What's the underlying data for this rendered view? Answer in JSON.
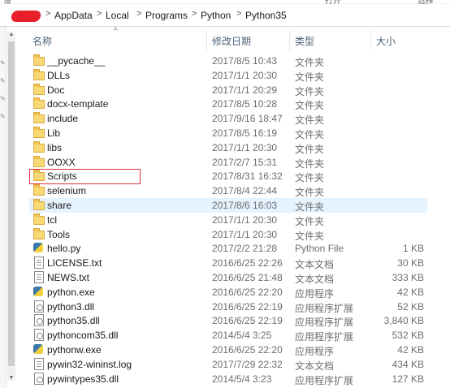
{
  "top_labels": [
    "设",
    "打开",
    "选择"
  ],
  "breadcrumb": {
    "items": [
      "AppData",
      "Local",
      "Programs",
      "Python",
      "Python35"
    ],
    "separator": ">"
  },
  "columns": {
    "name": "名称",
    "date": "修改日期",
    "type": "类型",
    "size": "大小"
  },
  "files": [
    {
      "name": "__pycache__",
      "date": "2017/8/5 10:43",
      "type": "文件夹",
      "size": "",
      "icon": "folder-icon"
    },
    {
      "name": "DLLs",
      "date": "2017/1/1 20:30",
      "type": "文件夹",
      "size": "",
      "icon": "folder-icon"
    },
    {
      "name": "Doc",
      "date": "2017/1/1 20:29",
      "type": "文件夹",
      "size": "",
      "icon": "folder-icon"
    },
    {
      "name": "docx-template",
      "date": "2017/8/5 10:28",
      "type": "文件夹",
      "size": "",
      "icon": "folder-icon"
    },
    {
      "name": "include",
      "date": "2017/9/16 18:47",
      "type": "文件夹",
      "size": "",
      "icon": "folder-icon"
    },
    {
      "name": "Lib",
      "date": "2017/8/5 16:19",
      "type": "文件夹",
      "size": "",
      "icon": "folder-icon"
    },
    {
      "name": "libs",
      "date": "2017/1/1 20:30",
      "type": "文件夹",
      "size": "",
      "icon": "folder-icon"
    },
    {
      "name": "OOXX",
      "date": "2017/2/7 15:31",
      "type": "文件夹",
      "size": "",
      "icon": "folder-icon"
    },
    {
      "name": "Scripts",
      "date": "2017/8/31 16:32",
      "type": "文件夹",
      "size": "",
      "icon": "folder-icon"
    },
    {
      "name": "selenium",
      "date": "2017/8/4 22:44",
      "type": "文件夹",
      "size": "",
      "icon": "folder-icon"
    },
    {
      "name": "share",
      "date": "2017/8/6 16:03",
      "type": "文件夹",
      "size": "",
      "icon": "folder-icon"
    },
    {
      "name": "tcl",
      "date": "2017/1/1 20:30",
      "type": "文件夹",
      "size": "",
      "icon": "folder-icon"
    },
    {
      "name": "Tools",
      "date": "2017/1/1 20:30",
      "type": "文件夹",
      "size": "",
      "icon": "folder-icon"
    },
    {
      "name": "hello.py",
      "date": "2017/2/2 21:28",
      "type": "Python File",
      "size": "1 KB",
      "icon": "python-file-icon"
    },
    {
      "name": "LICENSE.txt",
      "date": "2016/6/25 22:26",
      "type": "文本文档",
      "size": "30 KB",
      "icon": "text-file-icon"
    },
    {
      "name": "NEWS.txt",
      "date": "2016/6/25 21:48",
      "type": "文本文档",
      "size": "333 KB",
      "icon": "text-file-icon"
    },
    {
      "name": "python.exe",
      "date": "2016/6/25 22:20",
      "type": "应用程序",
      "size": "42 KB",
      "icon": "python-exe-icon"
    },
    {
      "name": "python3.dll",
      "date": "2016/6/25 22:19",
      "type": "应用程序扩展",
      "size": "52 KB",
      "icon": "dll-file-icon"
    },
    {
      "name": "python35.dll",
      "date": "2016/6/25 22:19",
      "type": "应用程序扩展",
      "size": "3,840 KB",
      "icon": "dll-file-icon"
    },
    {
      "name": "pythoncom35.dll",
      "date": "2014/5/4 3:25",
      "type": "应用程序扩展",
      "size": "532 KB",
      "icon": "dll-file-icon"
    },
    {
      "name": "pythonw.exe",
      "date": "2016/6/25 22:20",
      "type": "应用程序",
      "size": "42 KB",
      "icon": "python-exe-icon"
    },
    {
      "name": "pywin32-wininst.log",
      "date": "2017/7/29 22:32",
      "type": "文本文档",
      "size": "434 KB",
      "icon": "text-file-icon"
    },
    {
      "name": "pywintypes35.dll",
      "date": "2014/5/4 3:23",
      "type": "应用程序扩展",
      "size": "127 KB",
      "icon": "dll-file-icon"
    }
  ],
  "selected_row": "share",
  "highlighted_row": "Scripts",
  "colors": {
    "highlight_box": "#e0303a",
    "selection_bg": "#e5f3ff",
    "header_text": "#4c607a"
  }
}
